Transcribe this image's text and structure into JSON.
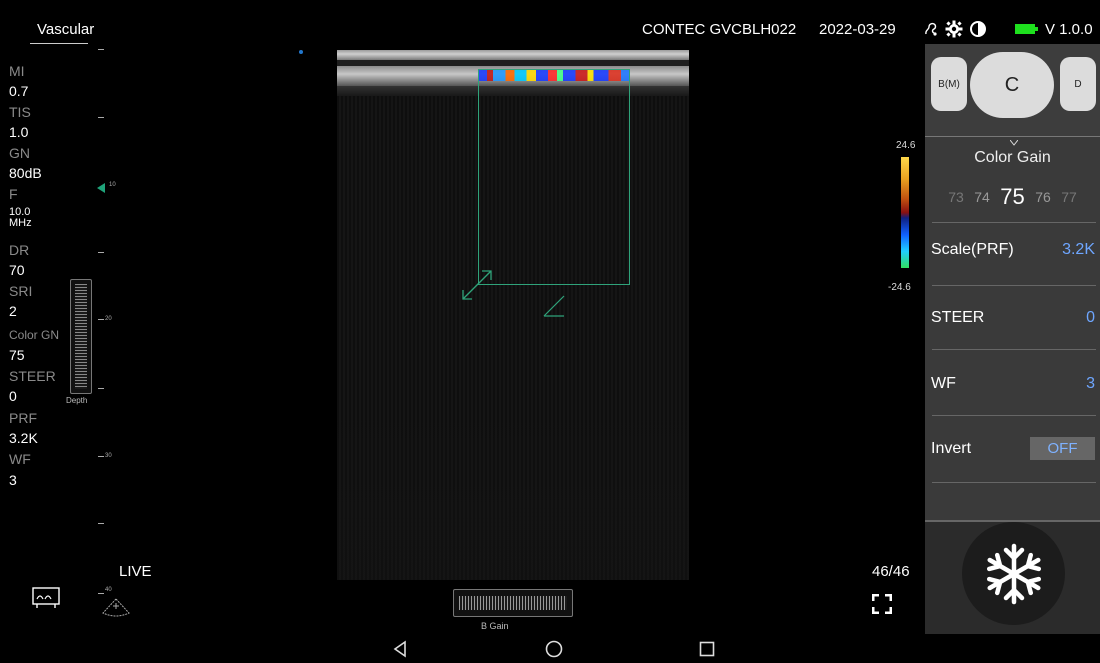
{
  "header": {
    "mode": "Vascular",
    "device": "CONTEC GVCBLH022",
    "date": "2022-03-29",
    "version": "V 1.0.0",
    "icons": [
      "probe-icon",
      "gear-icon",
      "contrast-icon",
      "battery-icon"
    ],
    "battery_color": "#1ee01e"
  },
  "params": [
    {
      "label": "MI",
      "value": "0.7"
    },
    {
      "label": "TIS",
      "value": "1.0"
    },
    {
      "label": "GN",
      "value": "80dB"
    },
    {
      "label": "F",
      "value": "10.0 MHz"
    },
    {
      "label": "DR",
      "value": "70"
    },
    {
      "label": "SRI",
      "value": "2"
    },
    {
      "label": "Color GN",
      "value": "75"
    },
    {
      "label": "STEER",
      "value": "0"
    },
    {
      "label": "PRF",
      "value": "3.2K"
    },
    {
      "label": "WF",
      "value": "3"
    }
  ],
  "depth_ruler": {
    "labels": [
      "10",
      "20",
      "30",
      "40"
    ]
  },
  "depth_slider_label": "Depth",
  "colorbar": {
    "max": "24.6",
    "min": "-24.6"
  },
  "mode_tabs": {
    "bm": "B(M)",
    "c": "C",
    "d": "D"
  },
  "color_gain": {
    "title": "Color Gain",
    "values": [
      "73",
      "74",
      "75",
      "76",
      "77"
    ],
    "selected": "75"
  },
  "settings": [
    {
      "label": "Scale(PRF)",
      "value": "3.2K"
    },
    {
      "label": "STEER",
      "value": "0"
    },
    {
      "label": "WF",
      "value": "3"
    }
  ],
  "invert": {
    "label": "Invert",
    "value": "OFF"
  },
  "status": {
    "live": "LIVE",
    "frames": "46/46"
  },
  "bgain_label": "B Gain",
  "accent_color": "#6ea6ff",
  "roi_color": "#2fa37a"
}
